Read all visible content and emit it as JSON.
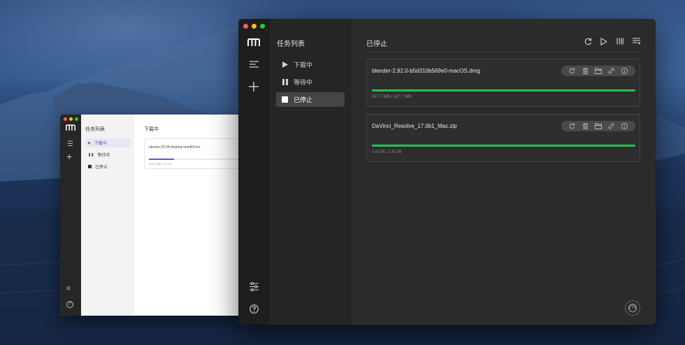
{
  "colors": {
    "accent_green": "#28c04f",
    "accent_purple": "#5b5bd6",
    "traffic_red": "#ff5f57",
    "traffic_yellow": "#febc2e",
    "traffic_green": "#28c840"
  },
  "background_window": {
    "nav": {
      "title": "任务列表",
      "items": [
        {
          "label": "下载中",
          "icon": "play-icon",
          "active": true
        },
        {
          "label": "等待中",
          "icon": "pause-icon",
          "active": false
        },
        {
          "label": "已停止",
          "icon": "stop-icon",
          "active": false
        }
      ]
    },
    "main": {
      "title": "下载中",
      "task": {
        "name": "ubuntu-20.04-desktop-amd64.iso",
        "size": "618.9 MB / 2.6 GB",
        "progress": 0.2
      }
    }
  },
  "window": {
    "rail": {
      "logo": "motrix-logo",
      "menu_icon": "menu-icon",
      "add_icon": "plus-icon",
      "settings_icon": "sliders-icon",
      "help_icon": "help-icon"
    },
    "nav": {
      "title": "任务列表",
      "items": [
        {
          "label": "下载中",
          "icon": "play-icon",
          "active": false
        },
        {
          "label": "等待中",
          "icon": "pause-icon",
          "active": false
        },
        {
          "label": "已停止",
          "icon": "stop-icon",
          "active": true
        }
      ]
    },
    "main": {
      "title": "已停止",
      "actions": [
        "refresh-icon",
        "resume-all-icon",
        "pause-all-icon",
        "purge-icon"
      ],
      "tasks": [
        {
          "name": "blender-2.92.0-b5d310b569e0-macOS.dmg",
          "size": "187.7 MB / 187.7 MB",
          "progress": 1.0,
          "tools": [
            "restart-icon",
            "trash-icon",
            "folder-icon",
            "link-icon",
            "info-icon"
          ]
        },
        {
          "name": "DaVinci_Resolve_17.0b1_Mac.zip",
          "size": "1.6 GB / 1.6 GB",
          "progress": 1.0,
          "tools": [
            "restart-icon",
            "trash-icon",
            "folder-icon",
            "link-icon",
            "info-icon"
          ]
        }
      ],
      "speedometer_icon": "speedometer-icon"
    }
  }
}
